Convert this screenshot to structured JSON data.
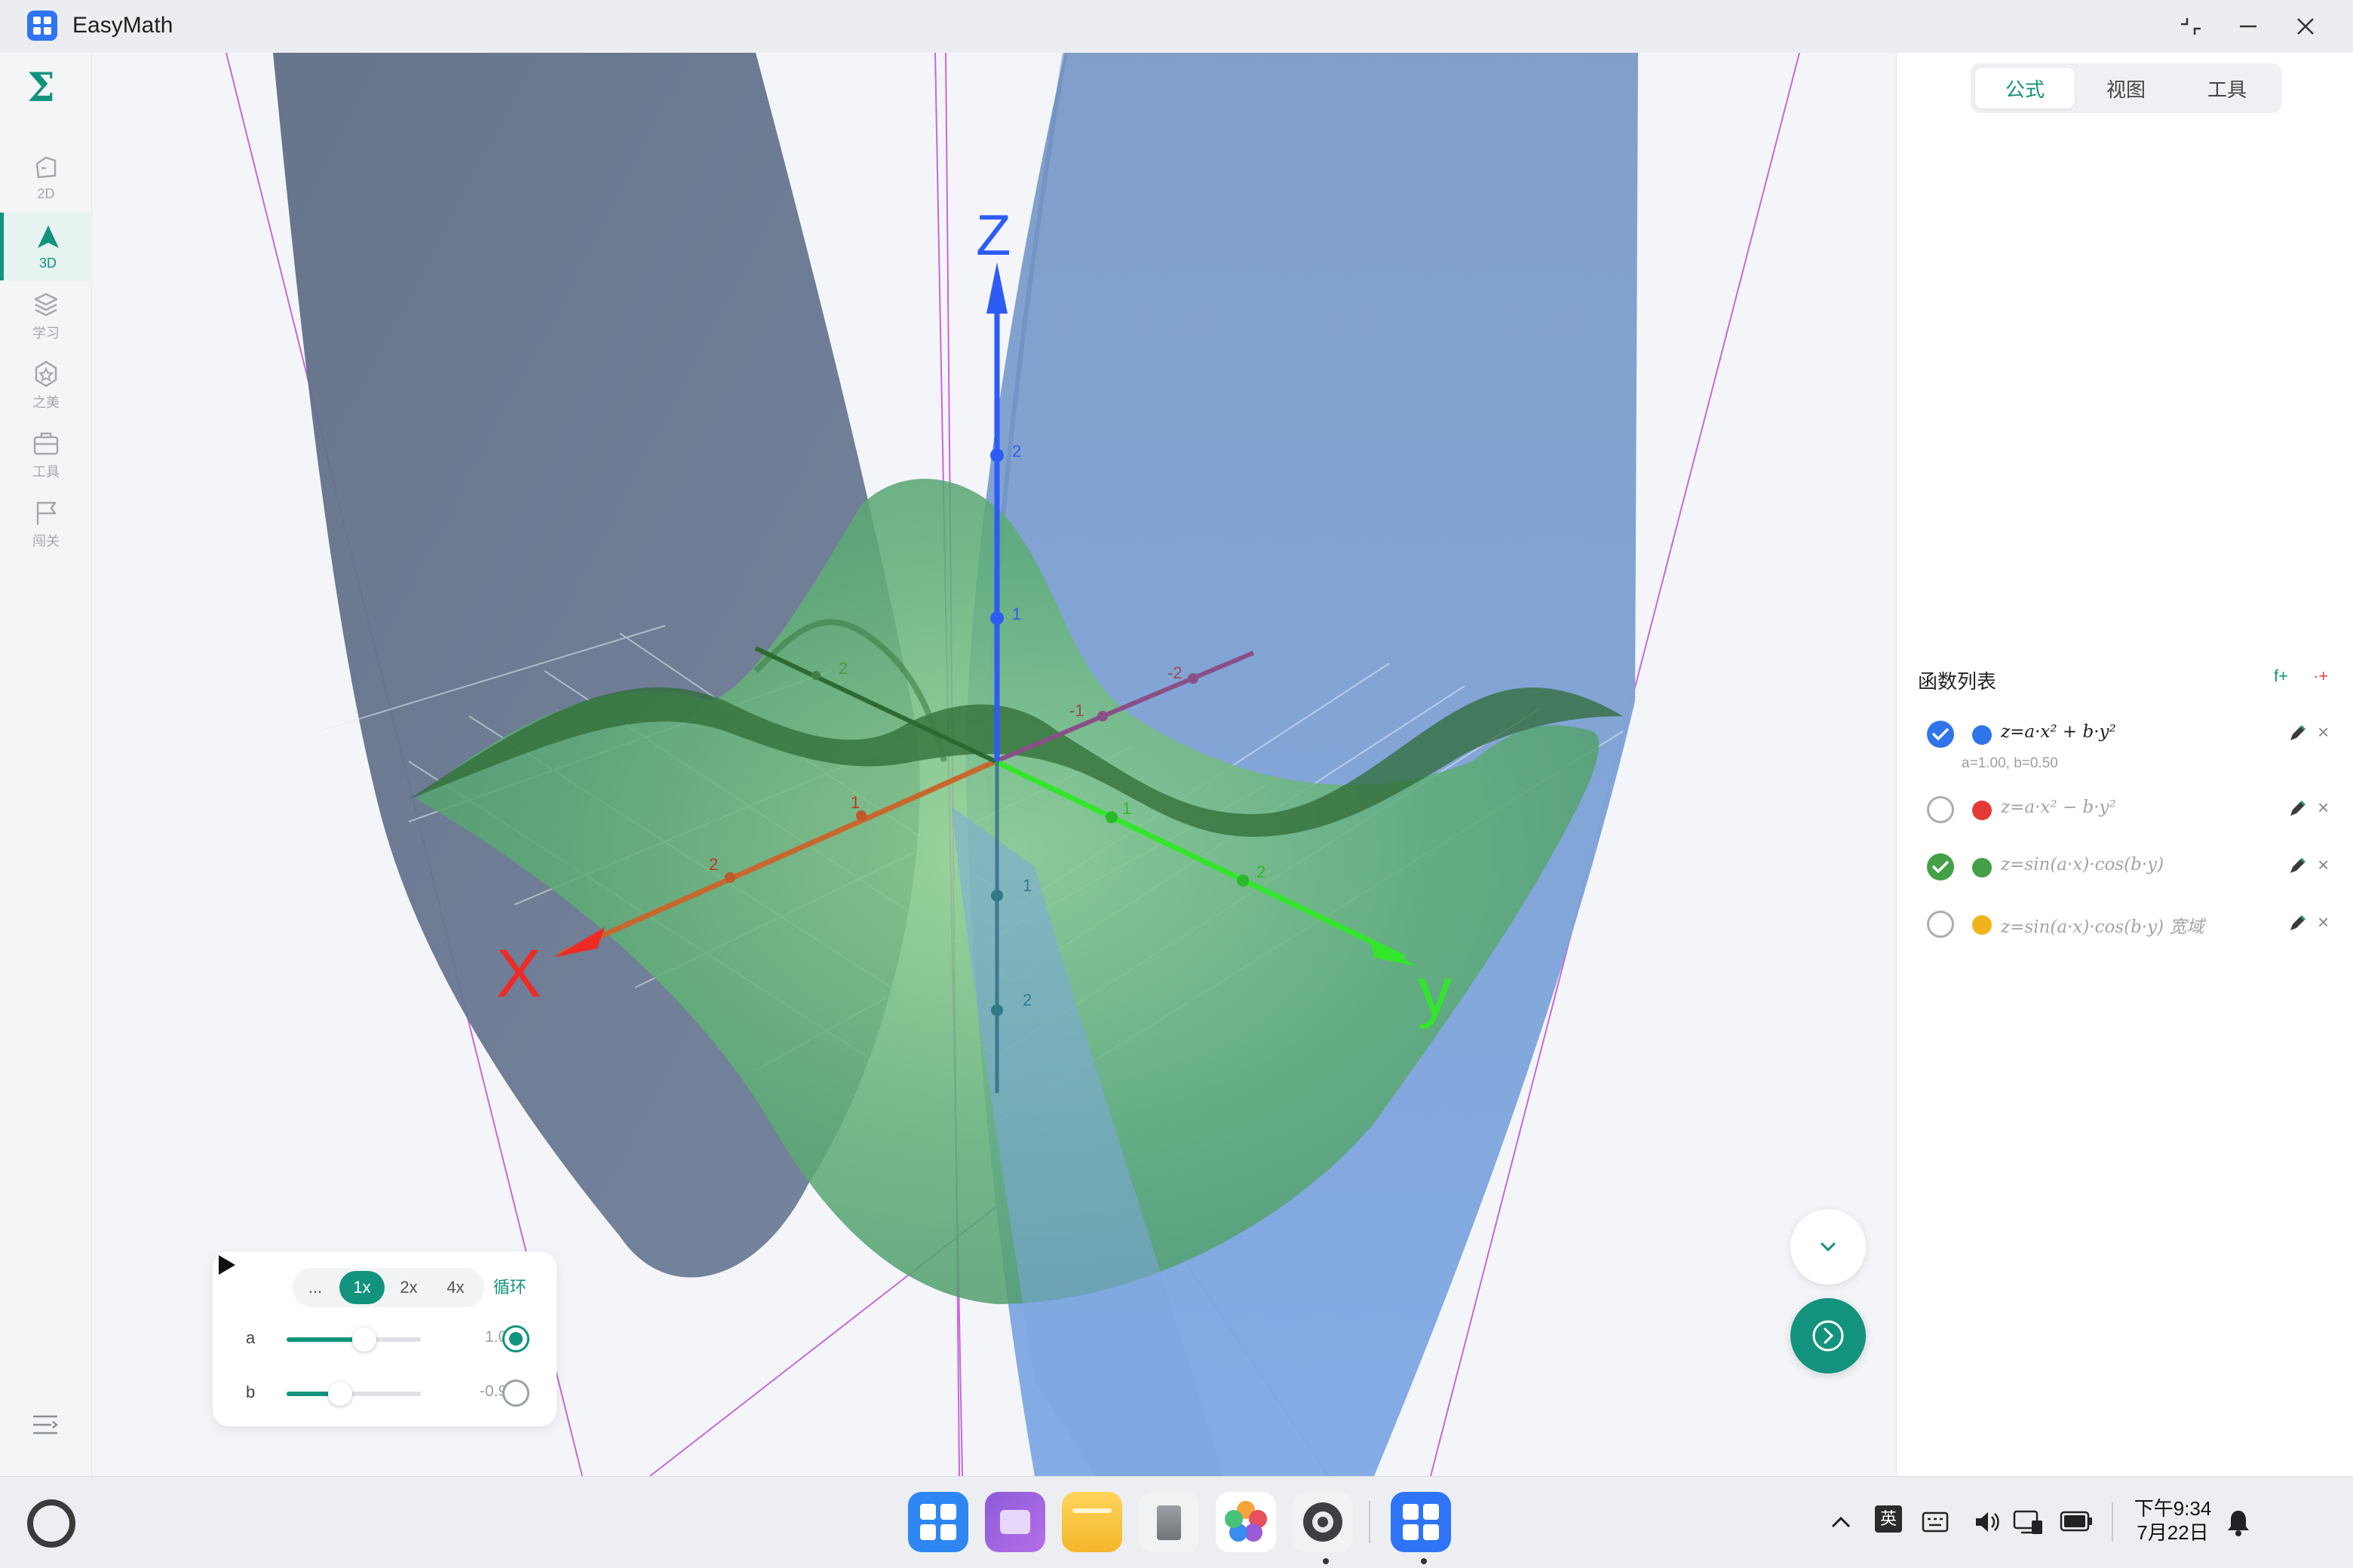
{
  "window": {
    "title": "EasyMath",
    "controls": [
      "restore",
      "minimize",
      "close"
    ]
  },
  "sidebar": {
    "logo": "Σ",
    "items": [
      {
        "label": "2D",
        "icon": "shape-2d-icon",
        "active": false
      },
      {
        "label": "3D",
        "icon": "shape-3d-icon",
        "active": true
      },
      {
        "label": "学习",
        "icon": "layers-icon",
        "active": false
      },
      {
        "label": "之美",
        "icon": "badge-icon",
        "active": false
      },
      {
        "label": "工具",
        "icon": "toolbox-icon",
        "active": false
      },
      {
        "label": "闯关",
        "icon": "flag-icon",
        "active": false
      }
    ],
    "bottom_icon": "menu-collapse-icon"
  },
  "graph": {
    "axes": {
      "x_label": "X",
      "y_label": "y",
      "z_label": "Z"
    },
    "x_ticks": [
      "1",
      "2"
    ],
    "y_ticks": [
      "1",
      "2"
    ],
    "z_ticks": [
      "2",
      "1",
      "1",
      "2"
    ],
    "neg_x_ticks": [
      "-1",
      "-2"
    ],
    "neg_y_ticks": [
      "2"
    ],
    "colors": {
      "x_axis": "#ee2a24",
      "y_axis": "#33e62c",
      "z_axis": "#2d5cf5",
      "surface_blue": "#6a95d6",
      "surface_green": "#6cbf78"
    }
  },
  "player": {
    "speeds": [
      "...",
      "1x",
      "2x",
      "4x"
    ],
    "active_speed": "1x",
    "loop_label": "循环",
    "params": [
      {
        "name": "a",
        "value": "1.00",
        "fraction": 0.58,
        "selected": true
      },
      {
        "name": "b",
        "value": "-0.94",
        "fraction": 0.4,
        "selected": false
      }
    ]
  },
  "panel": {
    "tabs": [
      "公式",
      "视图",
      "工具"
    ],
    "active_tab": "公式",
    "list_title": "函数列表",
    "add_function": "f+",
    "add_point": "·+",
    "functions": [
      {
        "expr": "z=a·x² + b·y²",
        "color": "#2f74e8",
        "checked": true,
        "check_color": "#2f74e8",
        "params": "a=1.00, b=0.50"
      },
      {
        "expr": "z=a·x² − b·y²",
        "color": "#e53935",
        "checked": false,
        "params": ""
      },
      {
        "expr": "z=sin(a·x)·cos(b·y)",
        "color": "#43a047",
        "checked": true,
        "check_color": "#43a047",
        "params": ""
      },
      {
        "expr": "z=sin(a·x)·cos(b·y) 宽域",
        "color": "#f2b21b",
        "checked": false,
        "params": ""
      }
    ]
  },
  "taskbar": {
    "apps": [
      "app-grid",
      "multitask",
      "files",
      "trash",
      "photos",
      "settings",
      "easymath"
    ],
    "tray": {
      "ime": "英"
    },
    "clock": {
      "time": "下午9:34",
      "date": "7月22日"
    }
  }
}
